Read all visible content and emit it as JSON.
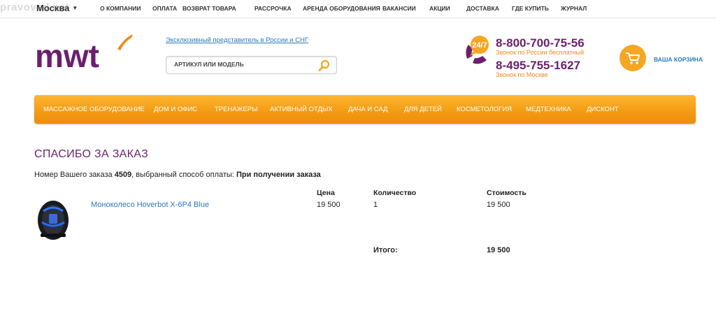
{
  "topbar": {
    "watermark": "pravoved.net",
    "city": "Москва",
    "links": [
      "О КОМПАНИИ",
      "ОПЛАТА",
      "ВОЗВРАТ ТОВАРА",
      "РАССРОЧКА",
      "АРЕНДА ОБОРУДОВАНИЯ",
      "ВАКАНСИИ",
      "АКЦИИ",
      "ДОСТАВКА",
      "ГДЕ КУПИТЬ",
      "ЖУРНАЛ"
    ]
  },
  "header": {
    "logo_text": "mwt",
    "exclusive_link": "Эксклюзивный представитель в России и СНГ",
    "search_placeholder": "АРТИКУЛ ИЛИ МОДЕЛЬ",
    "badge": "24/7",
    "phone1": "8-800-700-75-56",
    "phone1_note": "Звонок по России бесплатный",
    "phone2": "8-495-755-1627",
    "phone2_note": "Звонок по Москве",
    "cart_label": "ВАША КОРЗИНА"
  },
  "mainnav": [
    "МАССАЖНОЕ ОБОРУДОВАНИЕ",
    "ДОМ И ОФИС",
    "ТРЕНАЖЕРЫ",
    "АКТИВНЫЙ ОТДЫХ",
    "ДАЧА И САД",
    "ДЛЯ ДЕТЕЙ",
    "КОСМЕТОЛОГИЯ",
    "МЕДТЕХНИКА",
    "ДИСКОНТ"
  ],
  "order": {
    "title": "СПАСИБО ЗА ЗАКАЗ",
    "text_prefix": "Номер Вашего заказа ",
    "number": "4509",
    "text_middle": ", выбранный способ оплаты: ",
    "payment": "При получении заказа",
    "columns": {
      "price": "Цена",
      "qty": "Количество",
      "cost": "Стоимость"
    },
    "item": {
      "name": "Моноколесо Hoverbot X-6P4 Blue",
      "price": "19 500",
      "qty": "1",
      "cost": "19 500"
    },
    "total_label": "Итого:",
    "total_value": "19 500"
  },
  "colors": {
    "accent": "#f39a12",
    "brand": "#6b1f6e",
    "link": "#2a7bbf"
  }
}
